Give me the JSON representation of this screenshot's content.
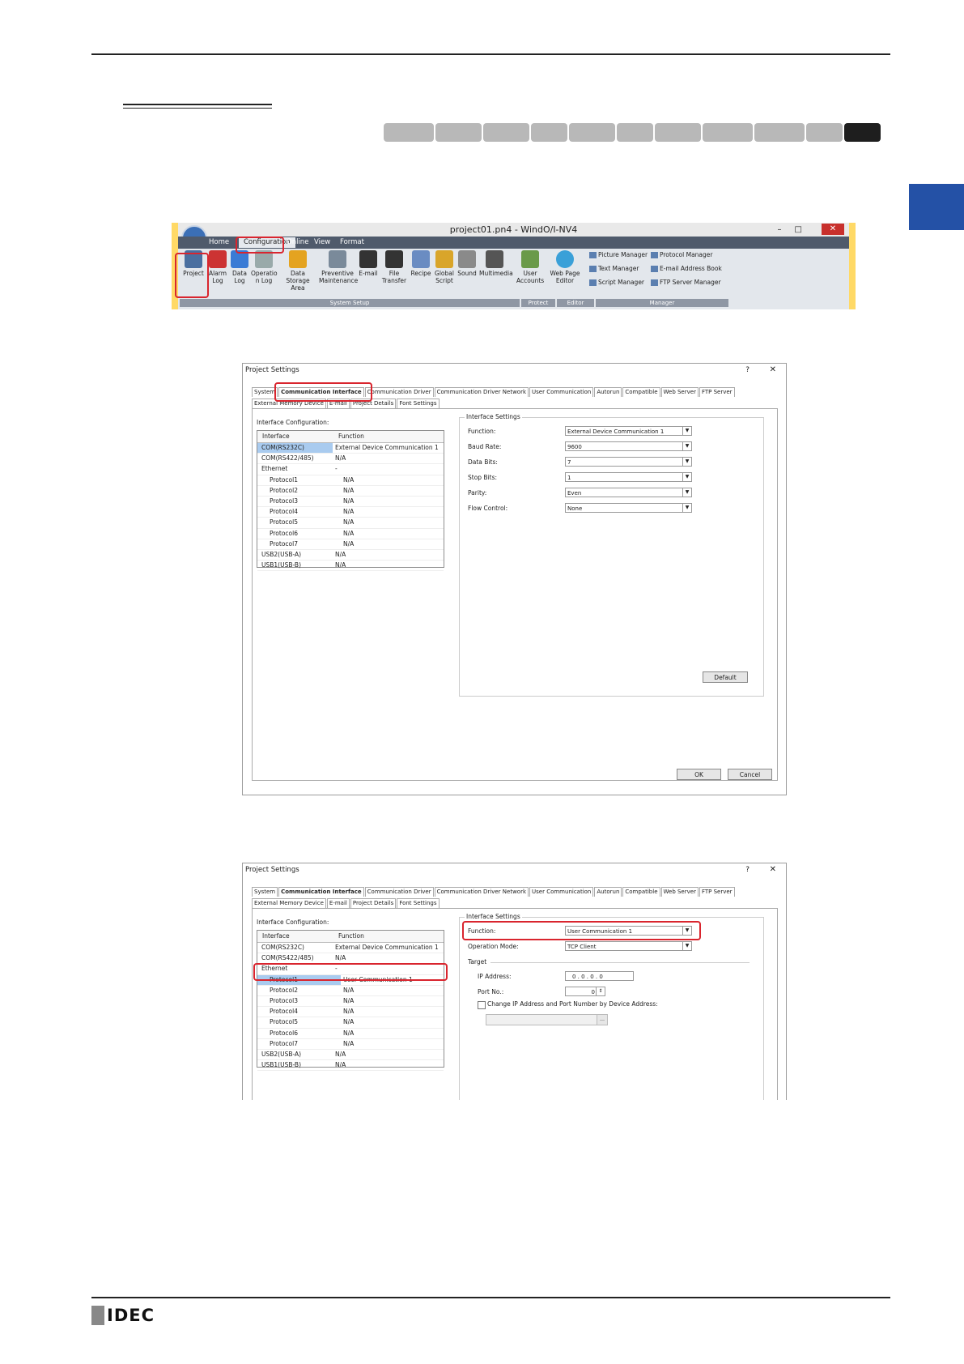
{
  "ribbon": {
    "window_title": "project01.pn4 - WindO/I-NV4",
    "tabs": [
      "Home",
      "Configuration",
      "Online",
      "View",
      "Format"
    ],
    "buttons": [
      {
        "label1": "Project",
        "label2": ""
      },
      {
        "label1": "Alarm",
        "label2": "Log"
      },
      {
        "label1": "Data",
        "label2": "Log"
      },
      {
        "label1": "Operatio",
        "label2": "n Log"
      },
      {
        "label1": "Data Storage",
        "label2": "Area"
      },
      {
        "label1": "Preventive",
        "label2": "Maintenance"
      },
      {
        "label1": "E-mail",
        "label2": ""
      },
      {
        "label1": "File",
        "label2": "Transfer"
      },
      {
        "label1": "Recipe",
        "label2": ""
      },
      {
        "label1": "Global",
        "label2": "Script"
      },
      {
        "label1": "Sound",
        "label2": ""
      },
      {
        "label1": "Multimedia",
        "label2": ""
      },
      {
        "label1": "User",
        "label2": "Accounts"
      },
      {
        "label1": "Web Page",
        "label2": "Editor"
      }
    ],
    "managers": [
      "Picture Manager",
      "Protocol Manager",
      "Text Manager",
      "E-mail Address Book",
      "Script Manager",
      "FTP Server Manager"
    ],
    "groups": [
      "System Setup",
      "Protect",
      "Editor",
      "Manager"
    ]
  },
  "dialog_tabs": [
    "System",
    "Communication Interface",
    "Communication Driver",
    "Communication Driver Network",
    "User Communication",
    "Autorun",
    "Compatible",
    "Web Server",
    "FTP Server"
  ],
  "dialog_tabs_row2": [
    "External Memory Device",
    "E-mail",
    "Project Details",
    "Font Settings"
  ],
  "dialog1": {
    "title": "Project Settings",
    "help": "?",
    "close": "✕",
    "iface_config_label": "Interface Configuration:",
    "col_interface": "Interface",
    "col_function": "Function",
    "rows": [
      {
        "iface": "COM(RS232C)",
        "func": "External Device Communication 1"
      },
      {
        "iface": "COM(RS422/485)",
        "func": "N/A"
      },
      {
        "iface": "Ethernet",
        "func": "-"
      },
      {
        "iface": "Protocol1",
        "func": "N/A"
      },
      {
        "iface": "Protocol2",
        "func": "N/A"
      },
      {
        "iface": "Protocol3",
        "func": "N/A"
      },
      {
        "iface": "Protocol4",
        "func": "N/A"
      },
      {
        "iface": "Protocol5",
        "func": "N/A"
      },
      {
        "iface": "Protocol6",
        "func": "N/A"
      },
      {
        "iface": "Protocol7",
        "func": "N/A"
      },
      {
        "iface": "USB2(USB-A)",
        "func": "N/A"
      },
      {
        "iface": "USB1(USB-B)",
        "func": "N/A"
      }
    ],
    "settings_label": "Interface Settings",
    "fields": [
      {
        "label": "Function:",
        "value": "External Device Communication 1"
      },
      {
        "label": "Baud Rate:",
        "value": "9600"
      },
      {
        "label": "Data Bits:",
        "value": "7"
      },
      {
        "label": "Stop Bits:",
        "value": "1"
      },
      {
        "label": "Parity:",
        "value": "Even"
      },
      {
        "label": "Flow Control:",
        "value": "None"
      }
    ],
    "default_btn": "Default",
    "ok_btn": "OK",
    "cancel_btn": "Cancel"
  },
  "dialog2": {
    "title": "Project Settings",
    "help": "?",
    "close": "✕",
    "iface_config_label": "Interface Configuration:",
    "col_interface": "Interface",
    "col_function": "Function",
    "rows": [
      {
        "iface": "COM(RS232C)",
        "func": "External Device Communication 1"
      },
      {
        "iface": "COM(RS422/485)",
        "func": "N/A"
      },
      {
        "iface": "Ethernet",
        "func": "-"
      },
      {
        "iface": "Protocol1",
        "func": "User Communication 1"
      },
      {
        "iface": "Protocol2",
        "func": "N/A"
      },
      {
        "iface": "Protocol3",
        "func": "N/A"
      },
      {
        "iface": "Protocol4",
        "func": "N/A"
      },
      {
        "iface": "Protocol5",
        "func": "N/A"
      },
      {
        "iface": "Protocol6",
        "func": "N/A"
      },
      {
        "iface": "Protocol7",
        "func": "N/A"
      },
      {
        "iface": "USB2(USB-A)",
        "func": "N/A"
      },
      {
        "iface": "USB1(USB-B)",
        "func": "N/A"
      }
    ],
    "settings_label": "Interface Settings",
    "function_label": "Function:",
    "function_value": "User Communication 1",
    "opmode_label": "Operation Mode:",
    "opmode_value": "TCP Client",
    "target_label": "Target",
    "ip_label": "IP Address:",
    "ip_value": "0 . 0 . 0 . 0",
    "port_label": "Port No.:",
    "port_value": "0",
    "change_label": "Change IP Address and Port Number by Device Address:"
  },
  "footer": {
    "brand": "IDEC"
  },
  "colors": {
    "accent_blue": "#2451a6",
    "highlight_red": "#d9252e",
    "ribbon_yellow": "#ffd966"
  }
}
